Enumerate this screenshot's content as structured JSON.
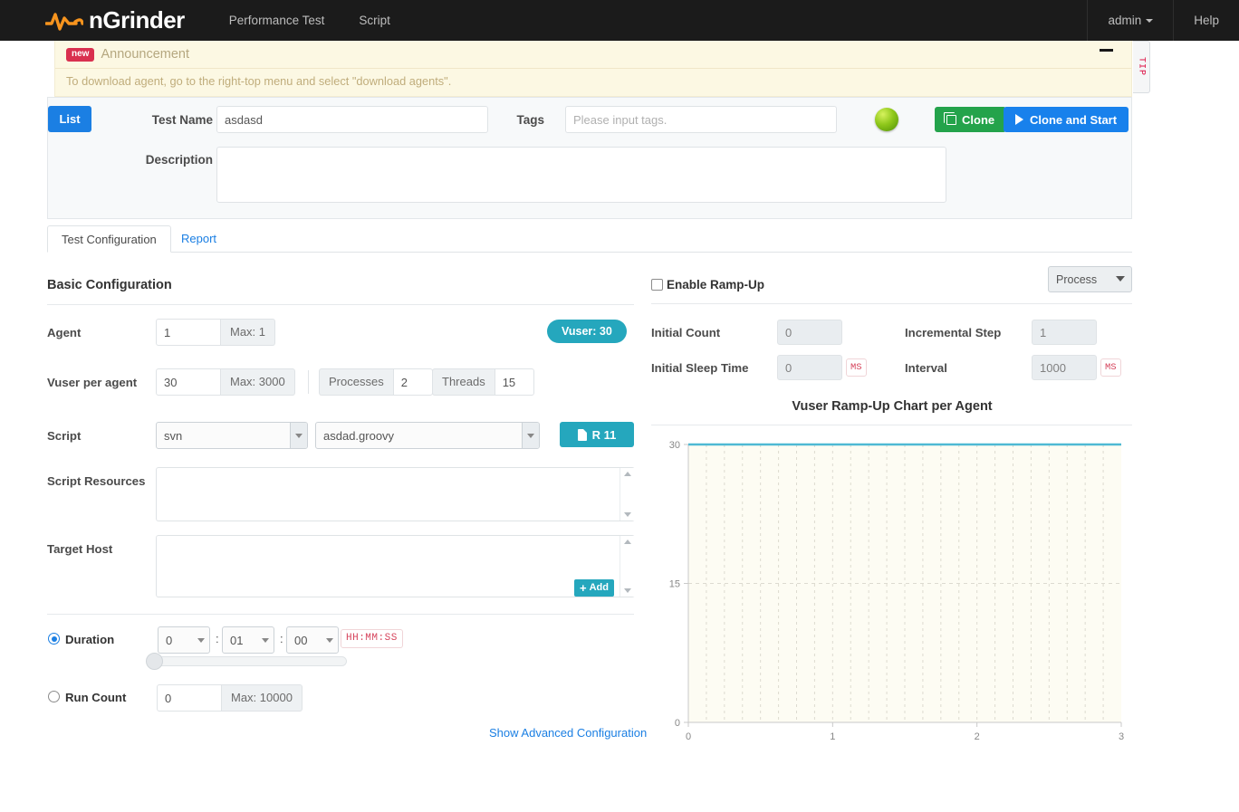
{
  "navbar": {
    "brand": "nGrinder",
    "links": [
      {
        "label": "Performance Test",
        "name": "nav-performance-test"
      },
      {
        "label": "Script",
        "name": "nav-script"
      }
    ],
    "user": "admin",
    "help": "Help"
  },
  "tip_tab": {
    "label": "TIP"
  },
  "announcement": {
    "badge": "new",
    "title": "Announcement",
    "body": "To download agent, go to the right-top menu and select \"download agents\".",
    "minimize_icon": "minimize-icon"
  },
  "test_header": {
    "list_button": "List",
    "test_name_label": "Test Name",
    "test_name_value": "asdasd",
    "tags_label": "Tags",
    "tags_placeholder": "Please input tags.",
    "description_label": "Description",
    "description_value": "",
    "status_icon": "green-status-ball",
    "clone_button": "Clone",
    "clone_and_start_button": "Clone and Start"
  },
  "tabs": [
    {
      "label": "Test Configuration",
      "active": true
    },
    {
      "label": "Report",
      "active": false
    }
  ],
  "basic_configuration": {
    "section_title": "Basic Configuration",
    "agent": {
      "label": "Agent",
      "value": "1",
      "max": "Max: 1"
    },
    "vuser_badge": "Vuser: 30",
    "vuser_per_agent": {
      "label": "Vuser per agent",
      "value": "30",
      "max": "Max: 3000"
    },
    "processes": {
      "label": "Processes",
      "value": "2"
    },
    "threads": {
      "label": "Threads",
      "value": "15"
    },
    "script": {
      "label": "Script",
      "source": "svn",
      "file": "asdad.groovy",
      "revision_button": "R 11"
    },
    "script_resources": {
      "label": "Script Resources",
      "value": ""
    },
    "target_host": {
      "label": "Target Host",
      "value": "",
      "add_button": "Add"
    },
    "duration": {
      "label": "Duration",
      "selected": true,
      "hours": "0",
      "minutes": "01",
      "seconds": "00",
      "format_hint": "HH:MM:SS"
    },
    "run_count": {
      "label": "Run Count",
      "selected": false,
      "value": "0",
      "max": "Max: 10000"
    },
    "advanced_link": "Show Advanced Configuration"
  },
  "ramp_up": {
    "enable_label": "Enable Ramp-Up",
    "enabled": false,
    "type_select": "Process",
    "initial_count": {
      "label": "Initial Count",
      "value": "0"
    },
    "initial_sleep_time": {
      "label": "Initial Sleep Time",
      "value": "0",
      "unit": "MS"
    },
    "incremental_step": {
      "label": "Incremental Step",
      "value": "1"
    },
    "interval": {
      "label": "Interval",
      "value": "1000",
      "unit": "MS"
    }
  },
  "colors": {
    "navbar": "#1b1b1b",
    "brand_orange": "#f7941e",
    "primary_blue": "#1881ec",
    "green": "#24a34b",
    "teal": "#25a7bd",
    "announce_bg": "#fcf8e3",
    "chart_line": "#4eb9d4",
    "chart_plot_bg": "#fdfcf3"
  },
  "chart_data": {
    "type": "line",
    "title": "Vuser Ramp-Up Chart per Agent",
    "xlabel": "",
    "ylabel": "",
    "xlim": [
      0,
      3
    ],
    "ylim": [
      0,
      30
    ],
    "xticks": [
      0,
      1,
      2,
      3
    ],
    "xtick_labels": [
      "0",
      "1",
      "2",
      "3"
    ],
    "yticks": [
      0,
      15,
      30
    ],
    "ytick_labels": [
      "0",
      "15",
      "30"
    ],
    "grid": {
      "vertical_dashed": true,
      "horizontal_dashed": true,
      "minor_step_x": 0.125
    },
    "legend": null,
    "series": [
      {
        "name": "Vuser",
        "color": "#4eb9d4",
        "x": [
          0,
          1,
          2,
          3
        ],
        "values": [
          30,
          30,
          30,
          30
        ]
      }
    ]
  }
}
